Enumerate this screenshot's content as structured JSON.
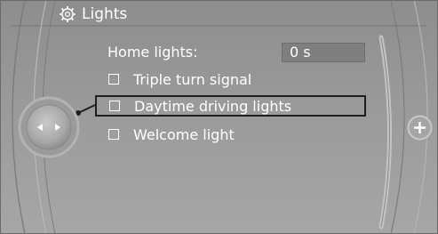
{
  "title": "Lights",
  "title_icon": "gear-light-icon",
  "home_lights": {
    "label": "Home lights:",
    "value": "0 s"
  },
  "options": [
    {
      "label": "Triple turn signal",
      "checked": false,
      "selected": false
    },
    {
      "label": "Daytime driving lights",
      "checked": false,
      "selected": true
    },
    {
      "label": "Welcome light",
      "checked": false,
      "selected": false
    }
  ],
  "nav_knob_icon": "left-right-arrows-icon",
  "plus_icon": "plus-icon",
  "colors": {
    "background": "#9a9a9a",
    "text": "#ffffff",
    "value_box": "#7f7f7f",
    "selection_border": "#1e1e1e"
  }
}
